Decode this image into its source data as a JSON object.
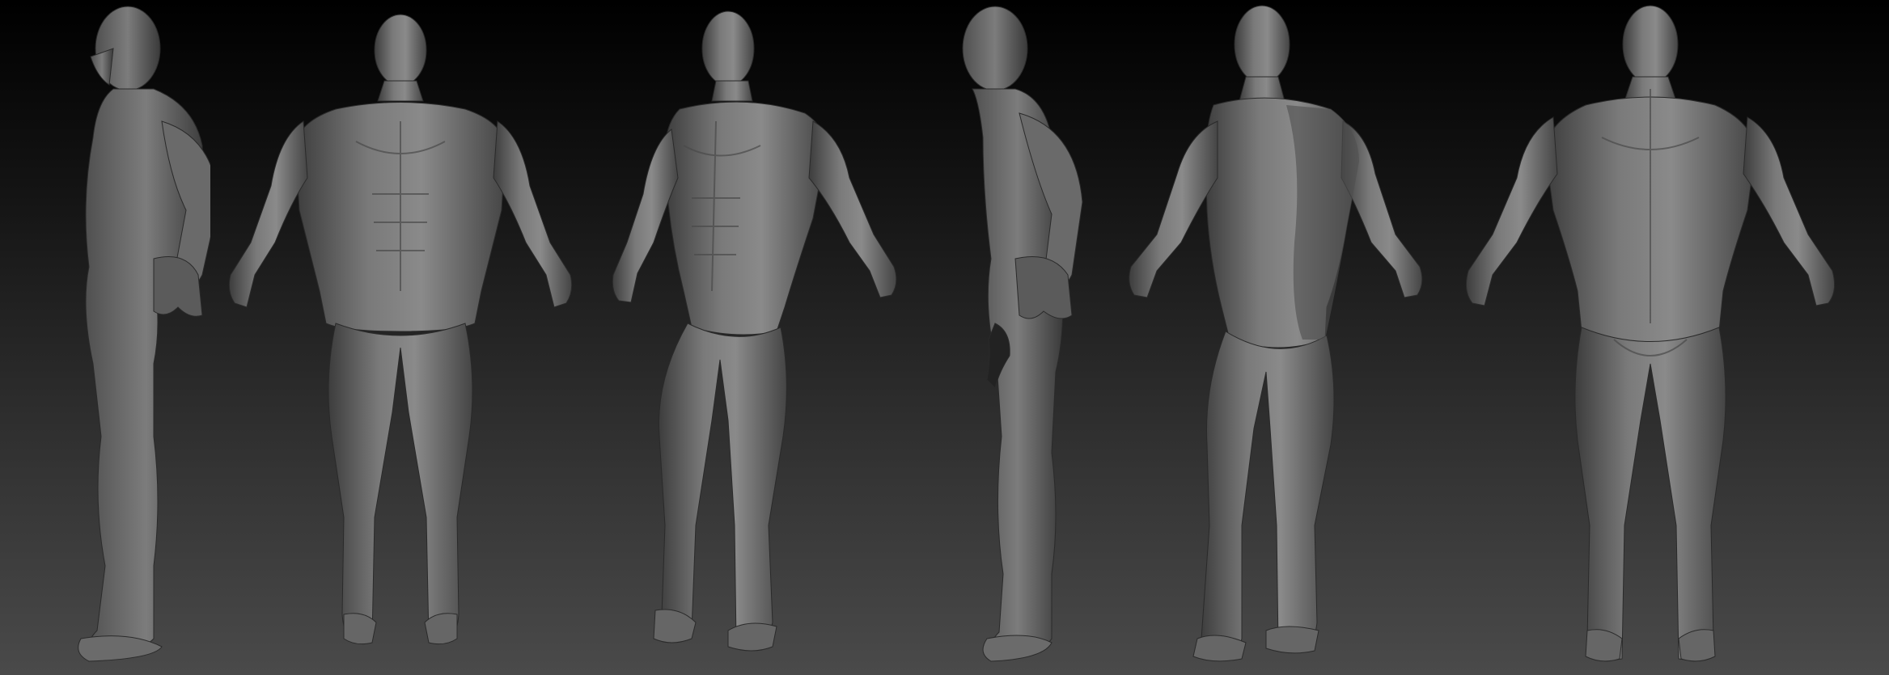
{
  "scene": {
    "figures": [
      {
        "view": "left-side"
      },
      {
        "view": "front"
      },
      {
        "view": "front-three-quarter"
      },
      {
        "view": "right-side"
      },
      {
        "view": "back-three-quarter"
      },
      {
        "view": "back"
      }
    ],
    "colors": {
      "clay": "#6f6f6f",
      "clay_light": "#8c8c8c",
      "clay_shadow": "#3a3a3a",
      "background_top": "#000000",
      "background_bottom": "#4a4a4a"
    }
  }
}
